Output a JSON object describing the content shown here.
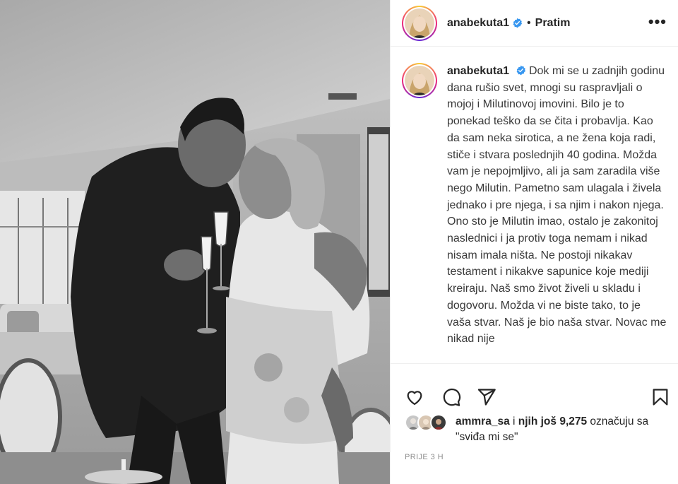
{
  "post": {
    "username": "anabekuta1",
    "follow_status": "Pratim",
    "separator": "•",
    "more_glyph": "•••",
    "caption_username": "anabekuta1",
    "caption": "Dok mi se u zadnjih godinu dana rušio svet, mnogi su raspravljali o mojoj i Milutinovoj imovini. Bilo je to ponekad teško da se čita i probavlja. Kao da sam neka sirotica, a ne žena koja radi, stiče i stvara poslednjih 40 godina. Možda vam je nepojmljivo, ali ja sam zaradila više nego Milutin. Pametno sam ulagala i živela jednako i pre njega, i sa njim i nakon njega. Ono sto je Milutin imao, ostalo je zakonitoj naslednici i ja protiv toga nemam i nikad nisam imala ništa. Ne postoji nikakav testament i nikakve sapunice koje mediji kreiraju. Naš smo život živeli u skladu i dogovoru. Možda vi ne biste tako, to je vaša stvar. Naš je bio naša stvar. Novac me nikad nije",
    "likes": {
      "first_user": "ammra_sa",
      "middle": " i ",
      "others": "njih još 9,275",
      "suffix": " označuju sa \"sviđa mi se\""
    },
    "timestamp": "PRIJE 3 H"
  },
  "icons": {
    "verified": "verified-badge-icon",
    "like": "heart-icon",
    "comment": "comment-icon",
    "share": "paper-plane-icon",
    "save": "bookmark-icon",
    "more": "more-options-icon"
  },
  "colors": {
    "verified": "#3897f0",
    "text": "#262626",
    "muted": "#8e8e8e",
    "border": "#efefef"
  }
}
